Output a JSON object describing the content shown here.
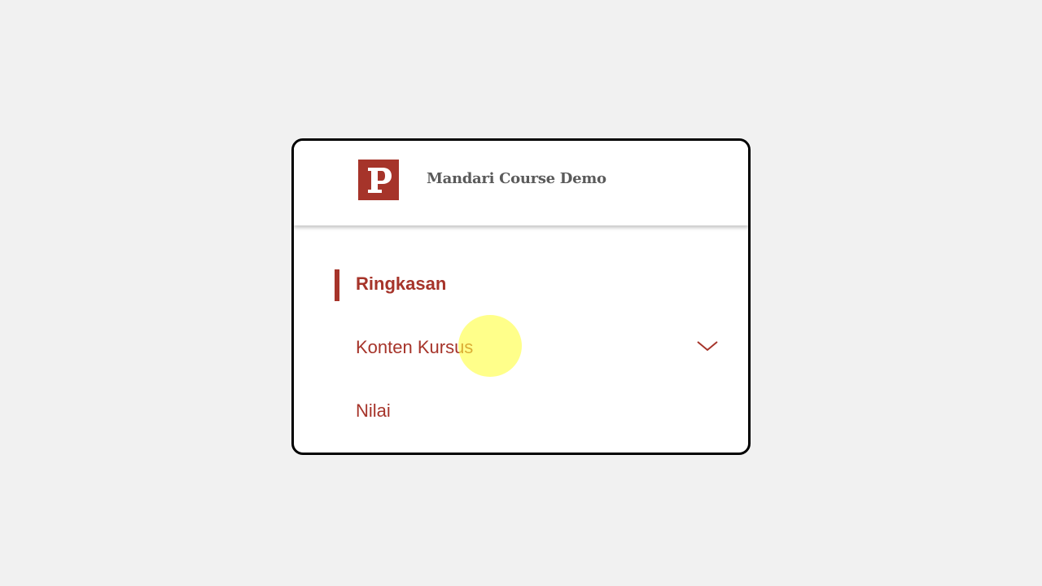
{
  "header": {
    "logo_letter": "P",
    "course_title": "Mandari Course Demo",
    "accent_color": "#a6342a"
  },
  "nav": {
    "items": [
      {
        "label": "Ringkasan",
        "active": true
      },
      {
        "label": "Konten Kursus",
        "active": false,
        "icon": "chevron-down-icon"
      },
      {
        "label": "Nilai",
        "active": false
      }
    ]
  }
}
